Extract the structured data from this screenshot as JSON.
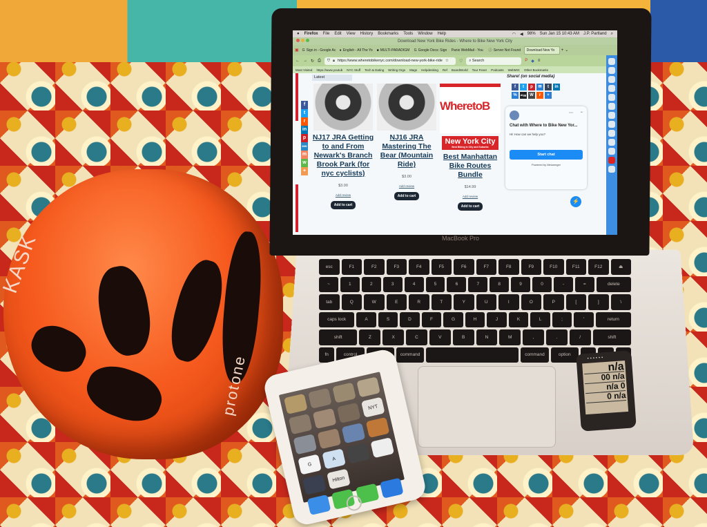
{
  "scene": {
    "description": "Desk photo: orange bike helmet, MacBook Pro showing a Firefox webpage, iPhone, and GPS bike computer on a patterned tablecloth"
  },
  "helmet": {
    "brand_text": "KASK",
    "model_text": "protone"
  },
  "laptop": {
    "brand": "MacBook Pro"
  },
  "menubar": {
    "apple": "",
    "app": "Firefox",
    "items": [
      "File",
      "Edit",
      "View",
      "History",
      "Bookmarks",
      "Tools",
      "Window",
      "Help"
    ],
    "battery": "98%",
    "datetime": "Sun Jan 15 10:43 AM",
    "user": "J.P. Partland"
  },
  "window": {
    "title": "Download New York Bike Rides - Where to Bike New York City"
  },
  "tabs": [
    {
      "label": "Sign in - Google Ac",
      "active": false
    },
    {
      "label": "English - All The Yo",
      "active": false
    },
    {
      "label": "MULTI-PARADIGM",
      "active": false
    },
    {
      "label": "Google Docs: Sign",
      "active": false
    },
    {
      "label": "Panix WebMail - You",
      "active": false
    },
    {
      "label": "Server Not Found",
      "active": false
    },
    {
      "label": "Download New Yo",
      "active": true
    }
  ],
  "navbar": {
    "url": "https://www.wheretobikenyc.com/download-new-york-bike-ride",
    "search_placeholder": "Search"
  },
  "bookmarks": [
    "Most Visited",
    "https://www.youtub",
    "NYC Stuff",
    "Tech & Dating",
    "Writing Orgs",
    "Mags",
    "Helpdesking",
    "Ref",
    "BoardWorld",
    "Tour Fever",
    "Podcasts",
    "WebMIC",
    "Other Bookmarks"
  ],
  "page": {
    "sort_select": "Latest",
    "left_share_icons": [
      "f",
      "t",
      "r",
      "in",
      "p",
      "MW",
      "m",
      "w",
      "+"
    ],
    "products": [
      {
        "title": "NJ17 JRA Getting to and From Newark's Branch Brook Park (for nyc cyclists)",
        "price": "$3.00",
        "review": "Add review",
        "button": "Add to cart",
        "image": "APPROVED JRA sticker"
      },
      {
        "title": "NJ16 JRA Mastering The Bear (Mountain Ride)",
        "price": "$3.00",
        "review": "Add review",
        "button": "Add to cart",
        "image": "APPROVED JRA sticker"
      },
      {
        "title": "Best Manhattan Bike Routes Bundle",
        "price": "$14.99",
        "review": "Add review",
        "button": "Add to cart",
        "image_logo": "WheretoB",
        "image_banner": "New York City",
        "image_tagline": "Best Biking in City and Suburbs"
      }
    ],
    "share_heading": "Share! (on social media)",
    "share_icons": [
      "f",
      "t",
      "p",
      "✉",
      "t",
      "in",
      "%",
      "digg",
      "W",
      "r",
      "+"
    ],
    "chat": {
      "title": "Chat with Where to Bike New Yor...",
      "greeting": "Hi! How can we help you?",
      "button": "Start chat",
      "powered": "Powered by Messenger"
    }
  },
  "keyboard": {
    "rows": [
      [
        "esc",
        "F1",
        "F2",
        "F3",
        "F4",
        "F5",
        "F6",
        "F7",
        "F8",
        "F9",
        "F10",
        "F11",
        "F12",
        "⏏"
      ],
      [
        "~",
        "1",
        "2",
        "3",
        "4",
        "5",
        "6",
        "7",
        "8",
        "9",
        "0",
        "-",
        "=",
        "delete"
      ],
      [
        "tab",
        "Q",
        "W",
        "E",
        "R",
        "T",
        "Y",
        "U",
        "I",
        "O",
        "P",
        "[",
        "]",
        "\\"
      ],
      [
        "caps lock",
        "A",
        "S",
        "D",
        "F",
        "G",
        "H",
        "J",
        "K",
        "L",
        ";",
        "'",
        "return"
      ],
      [
        "shift",
        "Z",
        "X",
        "C",
        "V",
        "B",
        "N",
        "M",
        ",",
        ".",
        "/",
        "shift"
      ],
      [
        "fn",
        "control",
        "option",
        "command",
        "",
        "command",
        "option",
        "◀",
        "▲▼",
        "▶"
      ]
    ]
  },
  "phone": {
    "apps": [
      "",
      "",
      "",
      "",
      "",
      "",
      "",
      "NYT",
      "",
      "",
      "",
      "",
      "G",
      "A",
      "",
      "",
      "",
      "Hilton",
      "",
      ""
    ],
    "dock": [
      "Safari",
      "Phone",
      "Messages",
      "Mail"
    ]
  },
  "gps": {
    "readings": [
      "n/a",
      "00",
      "n/a",
      "n/a",
      "0",
      "0",
      "n/a"
    ]
  }
}
